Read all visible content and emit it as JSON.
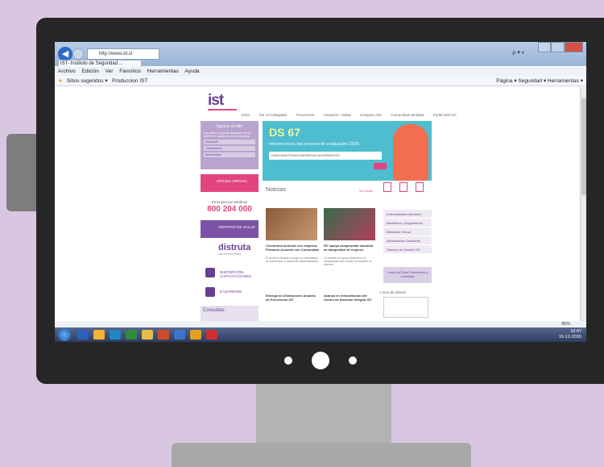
{
  "browser": {
    "address": "http://www.ist.cl",
    "tab": "IST- Instituto de Seguridad ...",
    "menu": [
      "Archivo",
      "Edición",
      "Ver",
      "Favoritos",
      "Herramientas",
      "Ayuda"
    ],
    "favorites": [
      "Sitios sugeridos ▾",
      "Produccion IST"
    ],
    "command_bar": "Página ▾  Seguridad ▾  Herramientas ▾",
    "zoom": "95%"
  },
  "taskbar": {
    "time": "16:47",
    "date": "16-12-2015",
    "icon_colors": [
      "#2a62bd",
      "#f2b337",
      "#1e88c5",
      "#2f8c3e",
      "#e5bc4b",
      "#d04b2f",
      "#3e73c7",
      "#e0a020",
      "#d03030"
    ]
  },
  "site": {
    "logo": "ist",
    "nav": [
      "Inicio",
      "Ser un trabajador",
      "Prevención",
      "Cesación / Salud",
      "Comprar vías",
      "Comunidad sanitaria",
      "Portal web IST"
    ],
    "left": {
      "box_title": "Ingreso al sitio",
      "box_text": "Los datos a ingresar dependen de su perfil en el sistema y de los servicios",
      "rows": [
        "Empresas",
        "Trabajadores",
        "Beneficiarios"
      ],
      "pink_btn": "OFICINA VIRTUAL",
      "phone_label": "Emergencias Médicas",
      "phone": "800 204 000",
      "violet_btn": "CENTROS DE SALUD",
      "distruta": "distruta",
      "distruta_sub": "club de beneficios",
      "links": [
        "INSCRIPCIÓN CAPACITACIONES",
        "E-LEARNING"
      ],
      "consultas": "Consultas"
    },
    "banner": {
      "title": "DS 67",
      "subtitle": "Informe inicio del proceso de evaluación 2015",
      "strip": "PARA NUESTRAS EMPRESAS ADHERENTES"
    },
    "noticias": "Noticias",
    "ver_todas": "Ver todas",
    "news": [
      {
        "title": "Ceremonia Acuerdo con empresa Firmaron Acuerdo con Comunidad",
        "text": "El acuerdo firmado incluye la contratación de prevención y asesorías especializadas."
      },
      {
        "title": "IST apoya campeonato nacional de básquetbol de mujeres",
        "text": "La entidad de apoyo financiero al campeonato que realizó el auspicio en deporte."
      },
      {
        "title": "Entrega de Distinciones Anuales de Prevención IST",
        "text": ""
      },
      {
        "title": "Avanza en remodelación del Centro de Atención Integral IST",
        "text": ""
      }
    ],
    "right_links": [
      "Enfermedades laborales",
      "Beneficios y Seguimiento",
      "Biblioteca Virtual",
      "Alimentación Saludable",
      "Sistema de Gestión IST"
    ],
    "canal": "Canal de Ética Prevención y consultas",
    "linea_label": "Línea de interés"
  }
}
